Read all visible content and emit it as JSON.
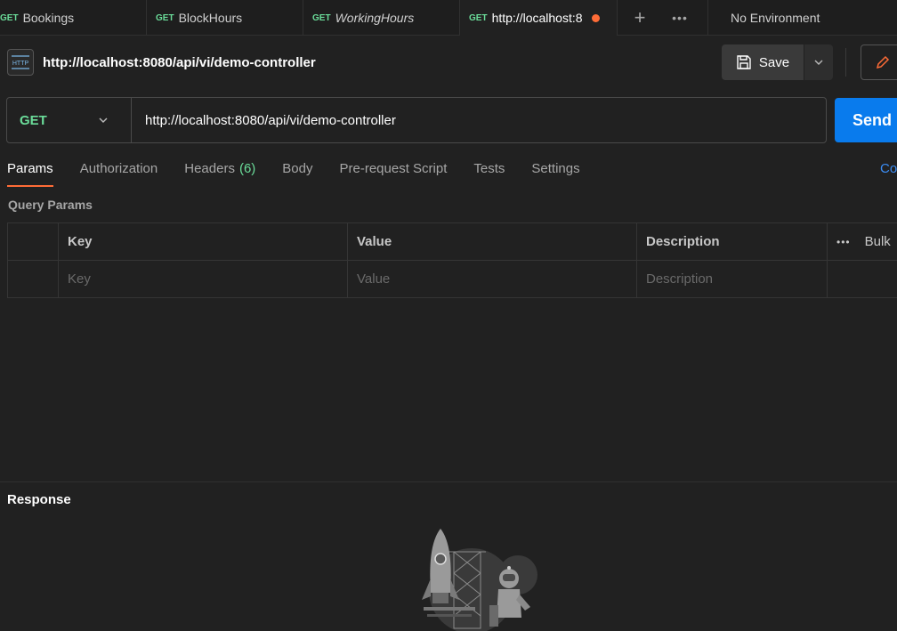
{
  "tabs": [
    {
      "method": "GET",
      "name": "Bookings"
    },
    {
      "method": "GET",
      "name": "BlockHours"
    },
    {
      "method": "GET",
      "name": "WorkingHours"
    },
    {
      "method": "GET",
      "name": "http://localhost:8"
    }
  ],
  "tabbar": {
    "new_tab": "+",
    "more": "•••",
    "environment": "No Environment"
  },
  "request": {
    "icon_label": "HTTP",
    "title": "http://localhost:8080/api/vi/demo-controller",
    "method": "GET",
    "url": "http://localhost:8080/api/vi/demo-controller"
  },
  "actions": {
    "save": "Save",
    "send": "Send"
  },
  "request_tabs": {
    "params": "Params",
    "authorization": "Authorization",
    "headers": "Headers",
    "headers_count": "(6)",
    "body": "Body",
    "prerequest": "Pre-request Script",
    "tests": "Tests",
    "settings": "Settings",
    "cookies": "Co"
  },
  "query_params": {
    "label": "Query Params",
    "columns": {
      "key": "Key",
      "value": "Value",
      "description": "Description",
      "bulk": "Bulk",
      "more": "•••"
    },
    "placeholders": {
      "key": "Key",
      "value": "Value",
      "description": "Description"
    }
  },
  "response": {
    "label": "Response"
  },
  "colors": {
    "accent": "#ff6c37",
    "get": "#6bdd9a",
    "send": "#097bed"
  }
}
